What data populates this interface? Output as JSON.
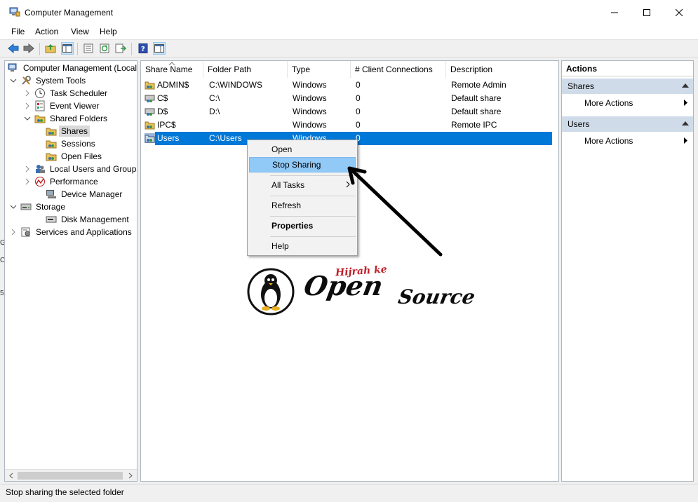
{
  "window": {
    "title": "Computer Management"
  },
  "menu": [
    "File",
    "Action",
    "View",
    "Help"
  ],
  "tree": {
    "root": "Computer Management (Local",
    "system_tools": "System Tools",
    "task_scheduler": "Task Scheduler",
    "event_viewer": "Event Viewer",
    "shared_folders": "Shared Folders",
    "shares": "Shares",
    "sessions": "Sessions",
    "open_files": "Open Files",
    "local_users": "Local Users and Groups",
    "performance": "Performance",
    "device_manager": "Device Manager",
    "storage": "Storage",
    "disk_management": "Disk Management",
    "services": "Services and Applications"
  },
  "list": {
    "columns": [
      "Share Name",
      "Folder Path",
      "Type",
      "# Client Connections",
      "Description"
    ],
    "rows": [
      {
        "name": "ADMIN$",
        "path": "C:\\WINDOWS",
        "type": "Windows",
        "connections": "0",
        "description": "Remote Admin"
      },
      {
        "name": "C$",
        "path": "C:\\",
        "type": "Windows",
        "connections": "0",
        "description": "Default share"
      },
      {
        "name": "D$",
        "path": "D:\\",
        "type": "Windows",
        "connections": "0",
        "description": "Default share"
      },
      {
        "name": "IPC$",
        "path": "",
        "type": "Windows",
        "connections": "0",
        "description": "Remote IPC"
      },
      {
        "name": "Users",
        "path": "C:\\Users",
        "type": "Windows",
        "connections": "0",
        "description": ""
      }
    ]
  },
  "context_menu": {
    "open": "Open",
    "stop_sharing": "Stop Sharing",
    "all_tasks": "All Tasks",
    "refresh": "Refresh",
    "properties": "Properties",
    "help": "Help"
  },
  "actions_pane": {
    "header": "Actions",
    "sections": [
      {
        "title": "Shares",
        "item": "More Actions"
      },
      {
        "title": "Users",
        "item": "More Actions"
      }
    ]
  },
  "status": "Stop sharing the selected folder",
  "logo": {
    "small": "Hijrah ke",
    "big_a": "Open",
    "big_b": "Source"
  },
  "edge_glyphs": [
    "G",
    "C",
    "5"
  ],
  "colors": {
    "selection": "#0078d7",
    "menu_hover": "#91c9f7",
    "action_section": "#cfdbe8"
  }
}
